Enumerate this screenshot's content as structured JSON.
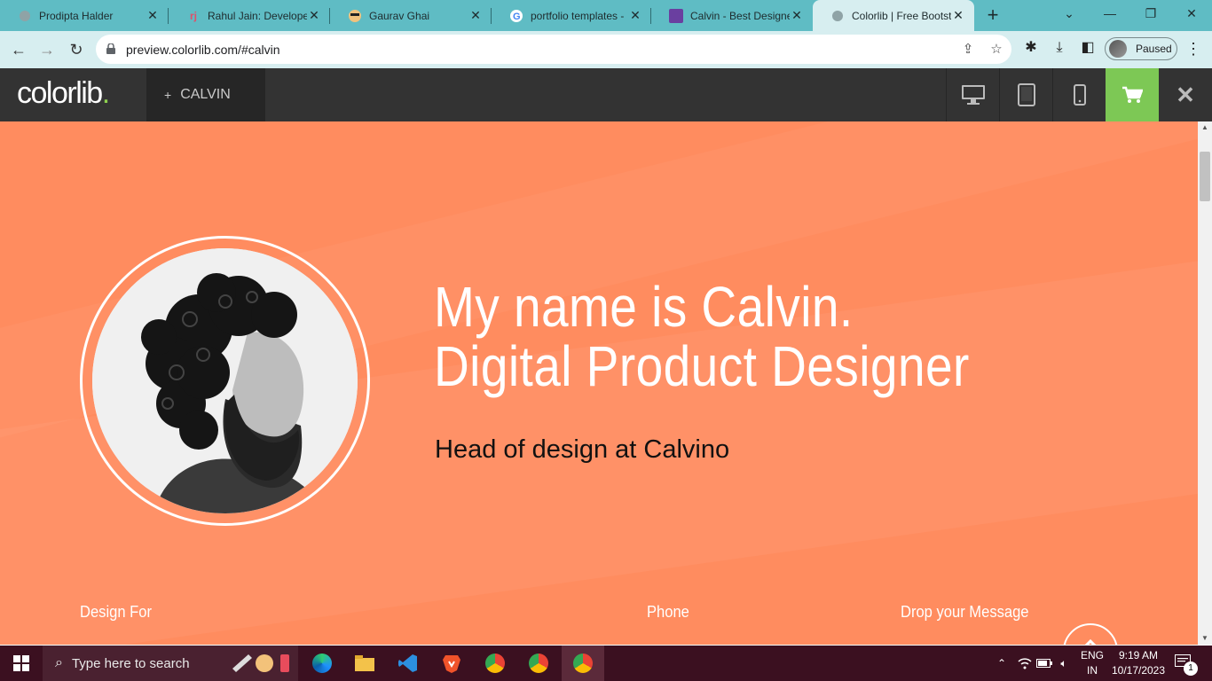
{
  "browser": {
    "tabs": [
      {
        "title": "Prodipta Halder",
        "icon": "globe-icon"
      },
      {
        "title": "Rahul Jain: Developer",
        "icon": "rj-icon"
      },
      {
        "title": "Gaurav Ghai",
        "icon": "avatar-icon"
      },
      {
        "title": "portfolio templates -",
        "icon": "google-icon"
      },
      {
        "title": "Calvin - Best Designe",
        "icon": "colorlib-icon"
      },
      {
        "title": "Colorlib | Free Bootst",
        "icon": "globe-icon"
      }
    ],
    "url": "preview.colorlib.com/#calvin",
    "profile_status": "Paused"
  },
  "colorlib_bar": {
    "logo": "colorlib",
    "logo_dot": ".",
    "theme_name": "CALVIN",
    "theme_prefix": "+",
    "accent": "#7dc855"
  },
  "hero": {
    "title_line1": "My name is Calvin.",
    "title_line2": "Digital Product Designer",
    "subtitle": "Head of design at Calvino",
    "background": "#ff8c5f",
    "footer_labels": [
      "Design For",
      "Phone",
      "Drop your Message"
    ]
  },
  "taskbar": {
    "search_placeholder": "Type here to search",
    "language_line1": "ENG",
    "language_line2": "IN",
    "time": "9:19 AM",
    "date": "10/17/2023",
    "notification_count": "1"
  }
}
